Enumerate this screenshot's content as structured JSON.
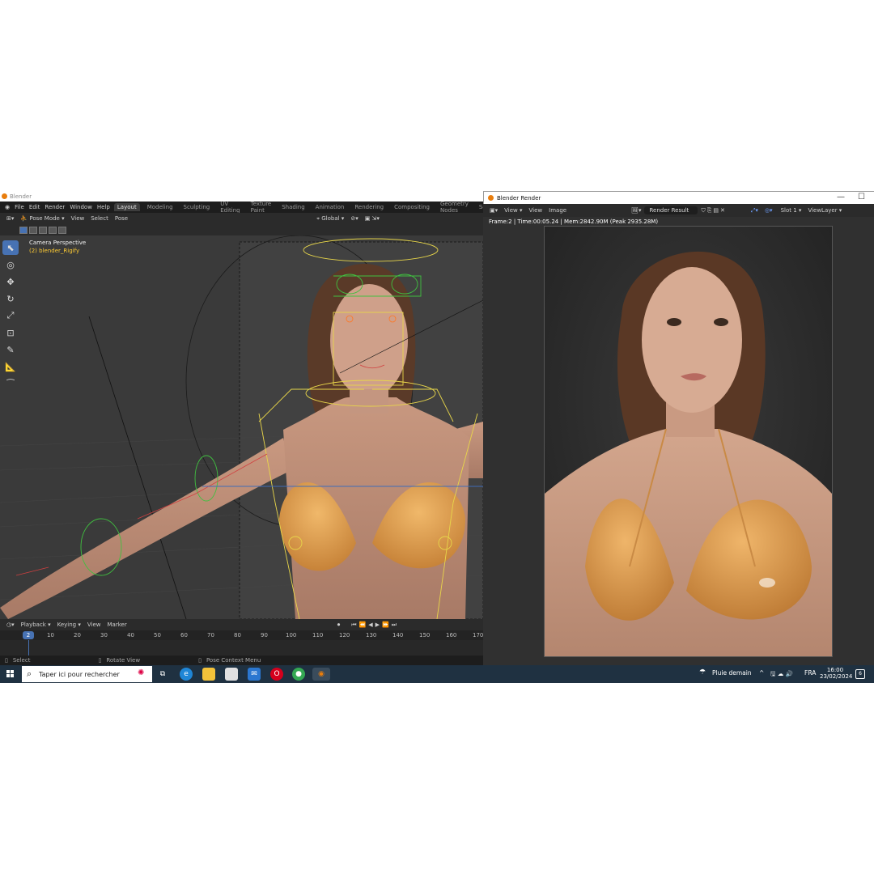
{
  "blender": {
    "title": "Blender",
    "menu": [
      "File",
      "Edit",
      "Render",
      "Window",
      "Help"
    ],
    "workspaces": [
      "Layout",
      "Modeling",
      "Sculpting",
      "UV Editing",
      "Texture Paint",
      "Shading",
      "Animation",
      "Rendering",
      "Compositing",
      "Geometry Nodes",
      "Scripting"
    ],
    "active_workspace": "Layout",
    "header": {
      "mode": "Pose Mode",
      "view": "View",
      "select": "Select",
      "pose": "Pose",
      "transform_orientation": "Global"
    },
    "viewport": {
      "camera_label": "Camera Perspective",
      "object_label": "(2) blender_Rigify"
    },
    "timeline": {
      "menu": [
        "Playback",
        "Keying",
        "View",
        "Marker"
      ],
      "current_frame": "2",
      "ticks": [
        "10",
        "20",
        "30",
        "40",
        "50",
        "60",
        "70",
        "80",
        "90",
        "100",
        "110",
        "120",
        "130",
        "140",
        "150",
        "160",
        "170"
      ]
    },
    "status": {
      "select": "Select",
      "rotate": "Rotate View",
      "context": "Pose Context Menu"
    },
    "accent": "#4772b3"
  },
  "render_window": {
    "title": "Blender Render",
    "menu": {
      "view": "View",
      "view2": "View",
      "image": "Image"
    },
    "image_name": "Render Result",
    "slot": "Slot 1",
    "layer": "ViewLayer",
    "info": "Frame:2 | Time:00:05.24 | Mem:2842.90M (Peak 2935.28M)"
  },
  "taskbar": {
    "search_placeholder": "Taper ici pour rechercher",
    "weather": "Pluie demain",
    "language": "FRA",
    "time": "16:00",
    "date": "23/02/2024",
    "notifications": "6"
  }
}
